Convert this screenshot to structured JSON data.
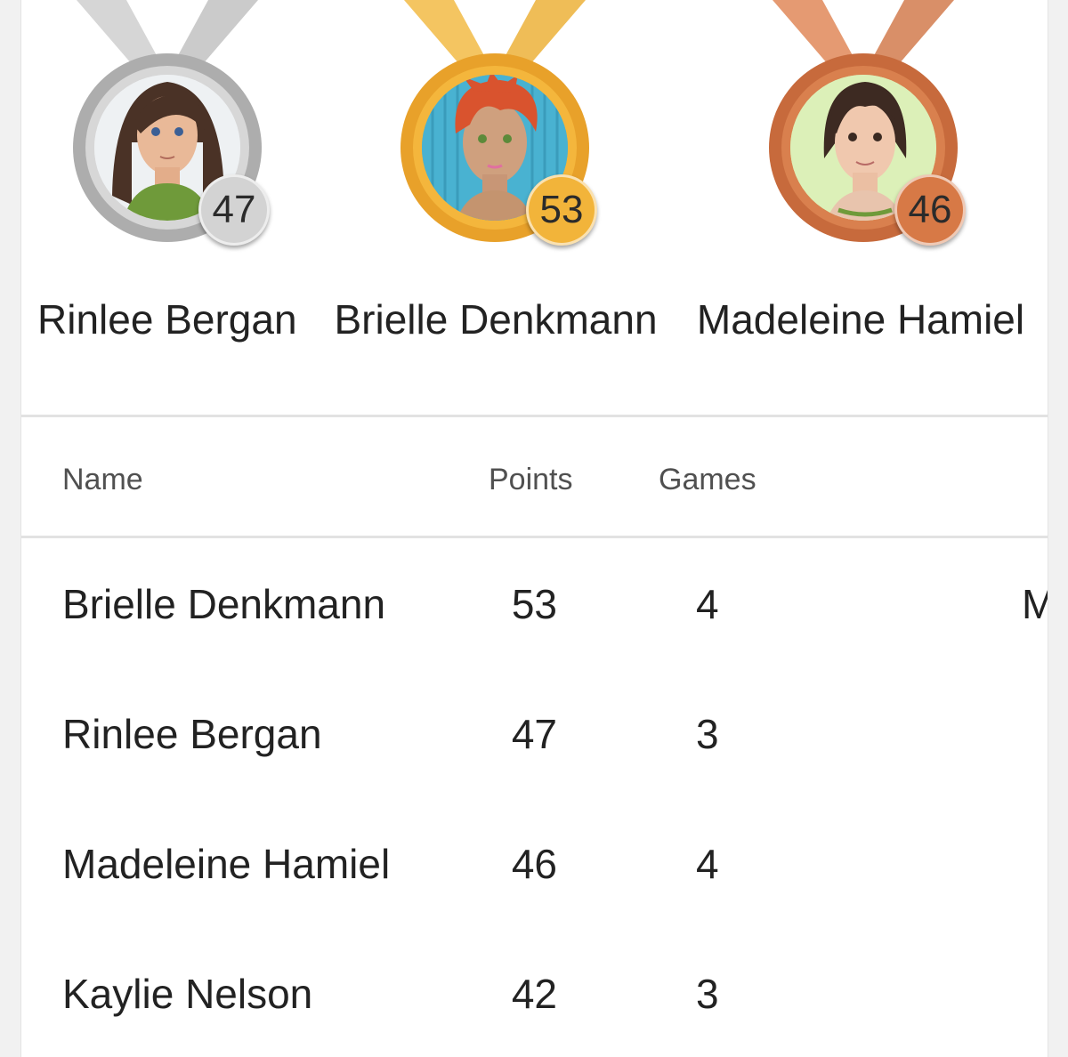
{
  "podium": [
    {
      "name": "Rinlee Bergan",
      "points": "47",
      "medal": "silver",
      "avatar": "avatar-long-brown-hair",
      "color": "#c9c9c9"
    },
    {
      "name": "Brielle Denkmann",
      "points": "53",
      "medal": "gold",
      "avatar": "avatar-red-hair",
      "color": "#f0b030"
    },
    {
      "name": "Madeleine Hamiel",
      "points": "46",
      "medal": "bronze",
      "avatar": "avatar-short-brown-hair",
      "color": "#d87a4a"
    }
  ],
  "table": {
    "headers": {
      "name": "Name",
      "points": "Points",
      "games": "Games"
    },
    "rows": [
      {
        "name": "Brielle Denkmann",
        "points": "53",
        "games": "4",
        "extra": "M"
      },
      {
        "name": "Rinlee Bergan",
        "points": "47",
        "games": "3",
        "extra": ""
      },
      {
        "name": "Madeleine Hamiel",
        "points": "46",
        "games": "4",
        "extra": ""
      },
      {
        "name": "Kaylie Nelson",
        "points": "42",
        "games": "3",
        "extra": ""
      }
    ]
  }
}
